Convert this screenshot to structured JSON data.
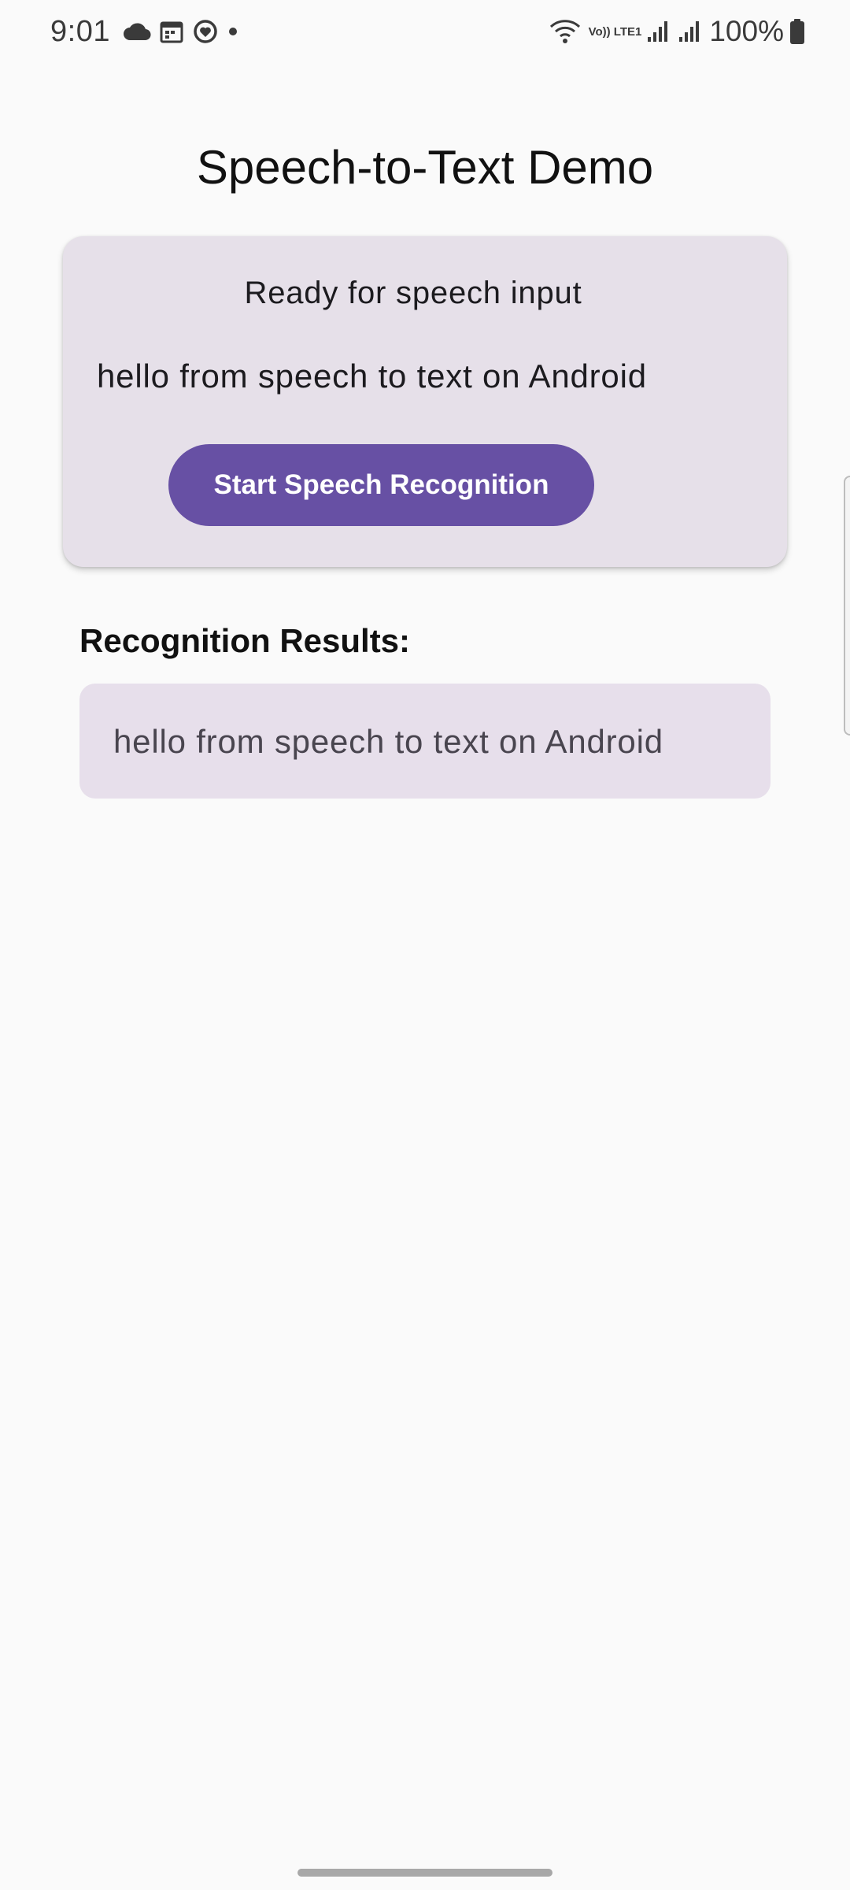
{
  "status_bar": {
    "time": "9:01",
    "battery_percent": "100%",
    "network_label": "Vo)) LTE1",
    "icons": [
      "cloud-icon",
      "calendar-icon",
      "heart-sync-icon",
      "dot-icon",
      "wifi-icon",
      "signal-icon",
      "signal-icon",
      "battery-icon"
    ]
  },
  "app": {
    "title": "Speech-to-Text Demo"
  },
  "card": {
    "status_text": "Ready for speech input",
    "transcript": "hello from speech to text on Android",
    "button_label": "Start Speech Recognition"
  },
  "results": {
    "heading": "Recognition Results:",
    "text": "hello from speech to text on Android"
  },
  "colors": {
    "primary": "#6750A4",
    "card_background": "#E6E0E9",
    "results_background": "#E7DFEB",
    "page_background": "#FAFAFA"
  }
}
